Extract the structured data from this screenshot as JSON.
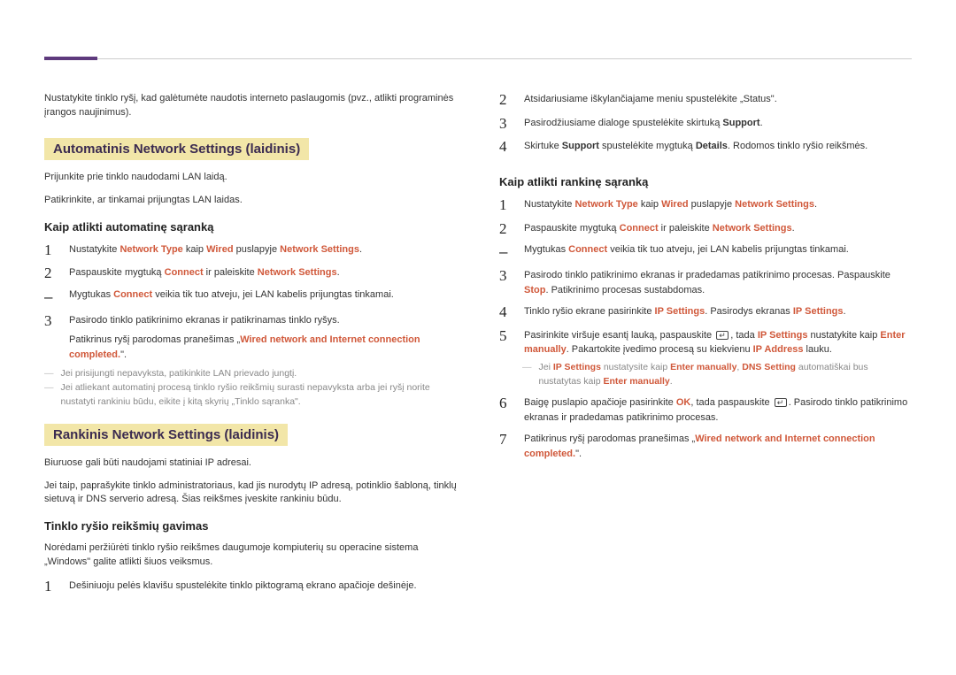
{
  "intro": "Nustatykite tinklo ryšį, kad galėtumėte naudotis interneto paslaugomis (pvz., atlikti programinės įrangos naujinimus).",
  "auto": {
    "title": "Automatinis Network Settings (laidinis)",
    "lines": [
      "Prijunkite prie tinklo naudodami LAN laidą.",
      "Patikrinkite, ar tinkamai prijungtas LAN laidas."
    ],
    "how_title": "Kaip atlikti automatinę sąranką",
    "steps": {
      "s1_a": "Nustatykite ",
      "s1_b": "Network Type",
      "s1_c": " kaip ",
      "s1_d": "Wired",
      "s1_e": " puslapyje ",
      "s1_f": "Network Settings",
      "s1_g": ".",
      "s2_a": "Paspauskite mygtuką ",
      "s2_b": "Connect",
      "s2_c": " ir paleiskite ",
      "s2_d": "Network Settings",
      "s2_e": ".",
      "sub_a": "Mygtukas ",
      "sub_b": "Connect",
      "sub_c": " veikia tik tuo atveju, jei LAN kabelis prijungtas tinkamai.",
      "s3_a": "Pasirodo tinklo patikrinimo ekranas ir patikrinamas tinklo ryšys.",
      "s3_b": "Patikrinus ryšį parodomas pranešimas „",
      "s3_c": "Wired network and Internet connection completed.",
      "s3_d": "\"."
    },
    "notes": [
      "Jei prisijungti nepavyksta, patikinkite LAN prievado jungtį.",
      "Jei atliekant automatinį procesą tinklo ryšio reikšmių surasti nepavyksta arba jei ryšį norite nustatyti rankiniu būdu, eikite į kitą skyrių „Tinklo sąranka\"."
    ]
  },
  "manual": {
    "title": "Rankinis Network Settings (laidinis)",
    "lines": [
      "Biuruose gali būti naudojami statiniai IP adresai.",
      "Jei taip, paprašykite tinklo administratoriaus, kad jis nurodytų IP adresą, potinklio šabloną, tinklų sietuvą ir DNS serverio adresą. Šias reikšmes įveskite rankiniu būdu."
    ],
    "values_title": "Tinklo ryšio reikšmių gavimas",
    "values_intro": "Norėdami peržiūrėti tinklo ryšio reikšmes daugumoje kompiuterių su operacine sistema „Windows\" galite atlikti šiuos veiksmus.",
    "vsteps": {
      "v1": "Dešiniuoju pelės klavišu spustelėkite tinklo piktogramą ekrano apačioje dešinėje.",
      "v2": "Atsidariusiame iškylančiajame meniu spustelėkite „Status\".",
      "v3_a": "Pasirodžiusiame dialoge spustelėkite skirtuką ",
      "v3_b": "Support",
      "v3_c": ".",
      "v4_a": "Skirtuke ",
      "v4_b": "Support",
      "v4_c": " spustelėkite mygtuką ",
      "v4_d": "Details",
      "v4_e": ". Rodomos tinklo ryšio reikšmės."
    },
    "manual_title": "Kaip atlikti rankinę sąranką",
    "msteps": {
      "m1_a": "Nustatykite ",
      "m1_b": "Network Type",
      "m1_c": " kaip ",
      "m1_d": "Wired",
      "m1_e": " puslapyje ",
      "m1_f": "Network Settings",
      "m1_g": ".",
      "m2_a": "Paspauskite mygtuką ",
      "m2_b": "Connect",
      "m2_c": " ir paleiskite ",
      "m2_d": "Network Settings",
      "m2_e": ".",
      "msub_a": "Mygtukas ",
      "msub_b": "Connect",
      "msub_c": " veikia tik tuo atveju, jei LAN kabelis prijungtas tinkamai.",
      "m3_a": "Pasirodo tinklo patikrinimo ekranas ir pradedamas patikrinimo procesas. Paspauskite ",
      "m3_b": "Stop",
      "m3_c": ". Patikrinimo procesas sustabdomas.",
      "m4_a": "Tinklo ryšio ekrane pasirinkite ",
      "m4_b": "IP Settings",
      "m4_c": ". Pasirodys ekranas ",
      "m4_d": "IP Settings",
      "m4_e": ".",
      "m5_a": "Pasirinkite viršuje esantį lauką, paspauskite ",
      "m5_b": ", tada ",
      "m5_c": "IP Settings",
      "m5_d": " nustatykite kaip ",
      "m5_e": "Enter manually",
      "m5_f": ". Pakartokite įvedimo procesą su kiekvienu ",
      "m5_g": "IP Address",
      "m5_h": " lauku.",
      "m5_note_a": "Jei ",
      "m5_note_b": "IP Settings",
      "m5_note_c": " nustatysite kaip ",
      "m5_note_d": "Enter manually",
      "m5_note_e": ", ",
      "m5_note_f": "DNS Setting",
      "m5_note_g": " automatiškai bus nustatytas kaip ",
      "m5_note_h": "Enter manually",
      "m5_note_i": ".",
      "m6_a": "Baigę puslapio apačioje pasirinkite ",
      "m6_b": "OK",
      "m6_c": ", tada paspauskite ",
      "m6_d": ". Pasirodo tinklo patikrinimo ekranas ir pradedamas patikrinimo procesas.",
      "m7_a": "Patikrinus ryšį parodomas pranešimas „",
      "m7_b": "Wired network and Internet connection completed.",
      "m7_c": "\"."
    }
  },
  "nums": {
    "n1": "1",
    "n2": "2",
    "n3": "3",
    "n4": "4",
    "n5": "5",
    "n6": "6",
    "n7": "7",
    "dash": "‒"
  }
}
